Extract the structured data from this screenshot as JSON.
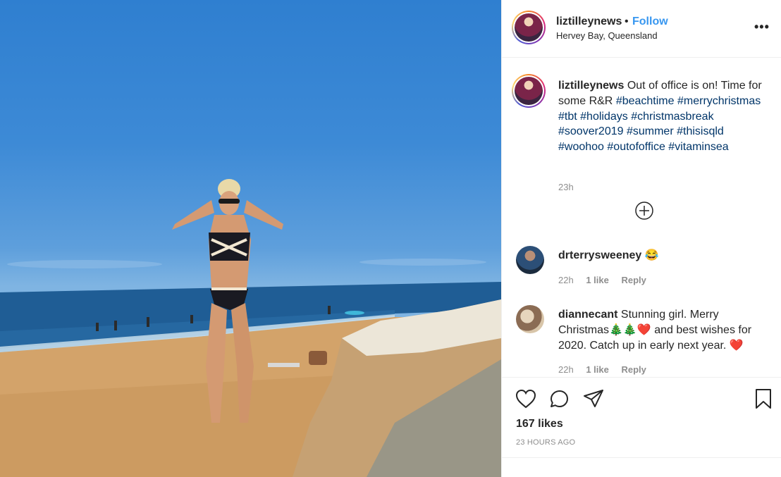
{
  "header": {
    "username": "liztilleynews",
    "separator": "•",
    "follow_label": "Follow",
    "location": "Hervey Bay, Queensland",
    "more_label": "•••"
  },
  "caption": {
    "username": "liztilleynews",
    "text": "Out of office is on! Time for some R&R",
    "hashtags": [
      "#beachtime",
      "#merrychristmas",
      "#tbt",
      "#holidays",
      "#christmasbreak",
      "#soover2019",
      "#summer",
      "#thisisqld",
      "#woohoo",
      "#outofoffice",
      "#vitaminsea"
    ],
    "time": "23h"
  },
  "comments": [
    {
      "username": "drterrysweeney",
      "text": "😂",
      "time": "22h",
      "likes": "1 like",
      "reply_label": "Reply"
    },
    {
      "username": "diannecant",
      "text": "Stunning girl. Merry Christmas🎄🎄❤️ and best wishes for 2020. Catch up in early next year. ❤️",
      "time": "22h",
      "likes": "1 like",
      "reply_label": "Reply"
    }
  ],
  "footer": {
    "likes": "167 likes",
    "timestamp": "23 HOURS AGO"
  },
  "icons": [
    "heart-icon",
    "comment-icon",
    "share-icon",
    "bookmark-icon",
    "load-more-icon",
    "more-options-icon"
  ],
  "colors": {
    "link": "#3897f0",
    "hashtag": "#003569",
    "muted": "#8e8e8e",
    "text": "#262626"
  }
}
